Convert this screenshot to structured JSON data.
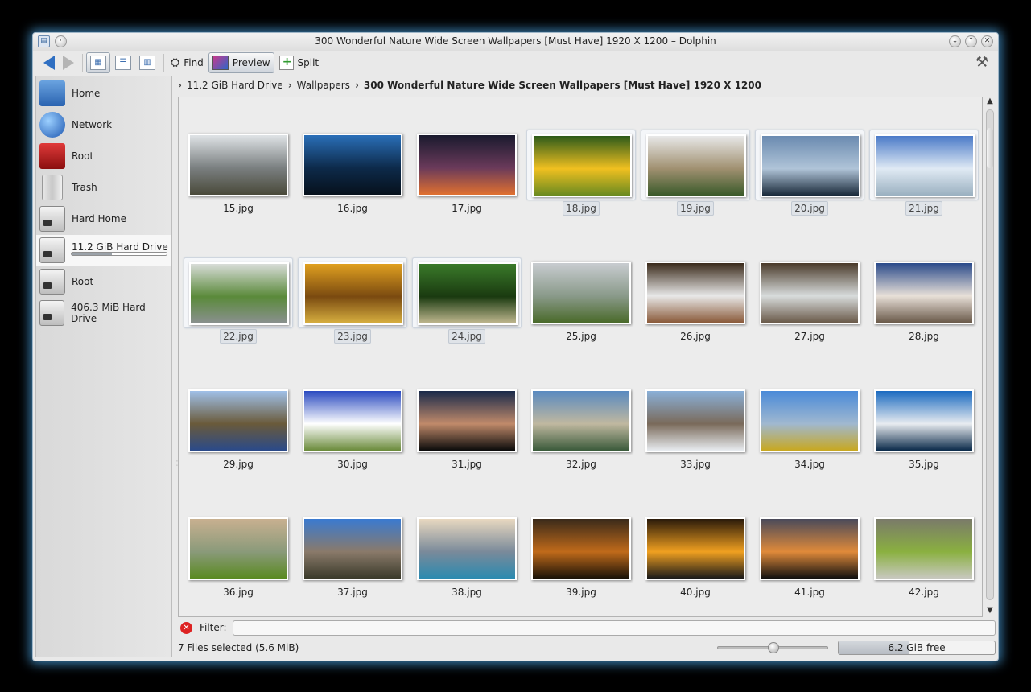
{
  "window": {
    "title": "300 Wonderful Nature Wide Screen Wallpapers [Must Have] 1920 X 1200 – Dolphin"
  },
  "toolbar": {
    "find_label": "Find",
    "preview_label": "Preview",
    "split_label": "Split"
  },
  "places": [
    {
      "label": "Home",
      "icon": "home-folder-icon"
    },
    {
      "label": "Network",
      "icon": "network-globe-icon"
    },
    {
      "label": "Root",
      "icon": "root-folder-icon"
    },
    {
      "label": "Trash",
      "icon": "trash-icon"
    },
    {
      "label": "Hard Home",
      "icon": "hard-drive-icon"
    },
    {
      "label": "11.2 GiB Hard Drive",
      "icon": "hard-drive-icon",
      "usage": 0.42
    },
    {
      "label": "Root",
      "icon": "hard-drive-icon"
    },
    {
      "label": "406.3 MiB Hard Drive",
      "icon": "hard-drive-icon"
    }
  ],
  "breadcrumb": {
    "items": [
      "11.2 GiB Hard Drive",
      "Wallpapers"
    ],
    "current": "300 Wonderful Nature Wide Screen Wallpapers [Must Have] 1920 X 1200"
  },
  "files": [
    {
      "name": "15.jpg",
      "selected": false,
      "colors": [
        "#dfe3e6",
        "#7a7f80",
        "#4a4a3a"
      ]
    },
    {
      "name": "16.jpg",
      "selected": false,
      "colors": [
        "#2a6fb8",
        "#0d2a4a",
        "#06111c"
      ]
    },
    {
      "name": "17.jpg",
      "selected": false,
      "colors": [
        "#1a1a2e",
        "#6a3a5a",
        "#e07030"
      ]
    },
    {
      "name": "18.jpg",
      "selected": true,
      "colors": [
        "#2c5a1a",
        "#f0c020",
        "#6a8a20"
      ]
    },
    {
      "name": "19.jpg",
      "selected": true,
      "colors": [
        "#e8e8e8",
        "#a09070",
        "#3a5a2a"
      ]
    },
    {
      "name": "20.jpg",
      "selected": true,
      "colors": [
        "#6a8ab0",
        "#b0c4d8",
        "#1a2a3a"
      ]
    },
    {
      "name": "21.jpg",
      "selected": true,
      "colors": [
        "#4a7ac8",
        "#e0eaf4",
        "#9ab0c0"
      ]
    },
    {
      "name": "22.jpg",
      "selected": true,
      "colors": [
        "#d8dcd8",
        "#5a8a3a",
        "#8a9090"
      ]
    },
    {
      "name": "23.jpg",
      "selected": true,
      "colors": [
        "#e0a020",
        "#7a4a10",
        "#d8b040"
      ]
    },
    {
      "name": "24.jpg",
      "selected": true,
      "colors": [
        "#3a7a2a",
        "#1a3a10",
        "#c0b890"
      ]
    },
    {
      "name": "25.jpg",
      "selected": false,
      "colors": [
        "#c8ccd0",
        "#8a9a8a",
        "#4a6a2a"
      ]
    },
    {
      "name": "26.jpg",
      "selected": false,
      "colors": [
        "#3a2a1a",
        "#e8e8e8",
        "#8a5a3a"
      ]
    },
    {
      "name": "27.jpg",
      "selected": false,
      "colors": [
        "#4a3a2a",
        "#d8dcdc",
        "#6a5a4a"
      ]
    },
    {
      "name": "28.jpg",
      "selected": false,
      "colors": [
        "#2a4a8a",
        "#e8e0d8",
        "#6a5a4a"
      ]
    },
    {
      "name": "29.jpg",
      "selected": false,
      "colors": [
        "#a0c0e8",
        "#6a5a3a",
        "#2a4a8a"
      ]
    },
    {
      "name": "30.jpg",
      "selected": false,
      "colors": [
        "#2a4ac0",
        "#ffffff",
        "#6a8a3a"
      ]
    },
    {
      "name": "31.jpg",
      "selected": false,
      "colors": [
        "#1a2a4a",
        "#c08a6a",
        "#0a0a0a"
      ]
    },
    {
      "name": "32.jpg",
      "selected": false,
      "colors": [
        "#5a8ac0",
        "#c0b8a0",
        "#3a5a3a"
      ]
    },
    {
      "name": "33.jpg",
      "selected": false,
      "colors": [
        "#8ab0d8",
        "#7a6a5a",
        "#e8ecf0"
      ]
    },
    {
      "name": "34.jpg",
      "selected": false,
      "colors": [
        "#4a8ad8",
        "#a0b8d0",
        "#c8a820"
      ]
    },
    {
      "name": "35.jpg",
      "selected": false,
      "colors": [
        "#1a6ac0",
        "#e8ecf0",
        "#0a2a4a"
      ]
    },
    {
      "name": "36.jpg",
      "selected": false,
      "colors": [
        "#c8b090",
        "#8a9a7a",
        "#5a8a20"
      ]
    },
    {
      "name": "37.jpg",
      "selected": false,
      "colors": [
        "#3a7ad0",
        "#8a7a6a",
        "#3a3a2a"
      ]
    },
    {
      "name": "38.jpg",
      "selected": false,
      "colors": [
        "#e8d8c0",
        "#7a8a9a",
        "#2a8ab0"
      ]
    },
    {
      "name": "39.jpg",
      "selected": false,
      "colors": [
        "#3a2a1a",
        "#c06a1a",
        "#1a1208"
      ]
    },
    {
      "name": "40.jpg",
      "selected": false,
      "colors": [
        "#2a1a0a",
        "#f0a020",
        "#1a1a1a"
      ]
    },
    {
      "name": "41.jpg",
      "selected": false,
      "colors": [
        "#4a4a5a",
        "#e08a3a",
        "#101010"
      ]
    },
    {
      "name": "42.jpg",
      "selected": false,
      "colors": [
        "#7a7a6a",
        "#8ab040",
        "#c8c8c0"
      ]
    }
  ],
  "filter": {
    "label": "Filter:",
    "value": ""
  },
  "status": {
    "selection_text": "7 Files selected (5.6 MiB)",
    "zoom_level": 0.5,
    "free_space_text": "6.2 GiB free",
    "used_fraction": 0.45
  },
  "colors": {
    "accent": "#2f6fc2",
    "window_glow": "#3a7fb0"
  }
}
